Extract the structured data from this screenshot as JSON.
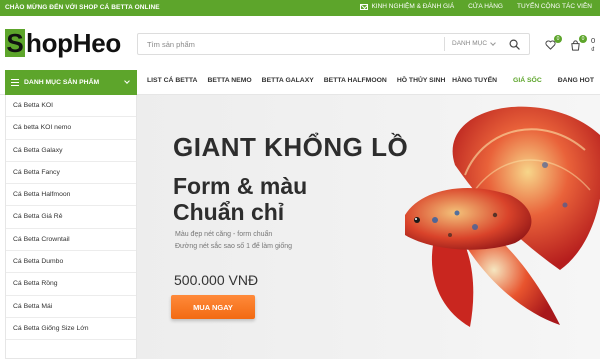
{
  "topbar": {
    "welcome": "CHÀO MỪNG ĐẾN VỚI SHOP CÁ BETTA ONLINE",
    "links": [
      "KINH NGHIỆM & ĐÁNH GIÁ",
      "CỬA HÀNG",
      "TUYỂN CỘNG TÁC VIÊN"
    ]
  },
  "header": {
    "logo_initial": "S",
    "logo_rest": "hopHeo",
    "search_placeholder": "Tìm sản phẩm",
    "category_select": "DANH MỤC",
    "wishlist_count": "0",
    "cart_count": "0",
    "cart_total": "0 ₫"
  },
  "nav": {
    "category_button": "DANH MỤC SẢN PHẨM",
    "menu": [
      "LIST CÁ BETTA",
      "BETTA NEMO",
      "BETTA GALAXY",
      "BETTA HALFMOON",
      "HỒ THỦY SINH"
    ],
    "menu_right": [
      "HÀNG TUYỂN",
      "GIÁ SỐC",
      "ĐANG HOT"
    ]
  },
  "sidebar": {
    "items": [
      "Cá Betta KOI",
      "Cá betta KOI nemo",
      "Cá Betta Galaxy",
      "Cá Betta Fancy",
      "Cá Betta Halfmoon",
      "Cá Betta Giá Rẻ",
      "Cá Betta Crowntail",
      "Cá Betta Dumbo",
      "Cá Betta Rồng",
      "Cá Betta Mái",
      "Cá Betta Giống Size Lớn"
    ]
  },
  "banner": {
    "headline": "GIANT KHỔNG LỒ",
    "line1": "Form & màu",
    "line2": "Chuẩn chỉ",
    "desc1": "Màu đẹp nét căng - form chuẩn",
    "desc2": "Đường nét sắc sao số 1 để làm giống",
    "price": "500.000 VNĐ",
    "cta": "MUA NGAY"
  },
  "colors": {
    "brand_green": "#5da52b",
    "cta_orange": "#f26a12",
    "hot_label": "#5da52b"
  },
  "icons": [
    "mail-icon",
    "search-icon",
    "heart-icon",
    "cart-icon",
    "menu-icon",
    "chevron-down-icon"
  ]
}
